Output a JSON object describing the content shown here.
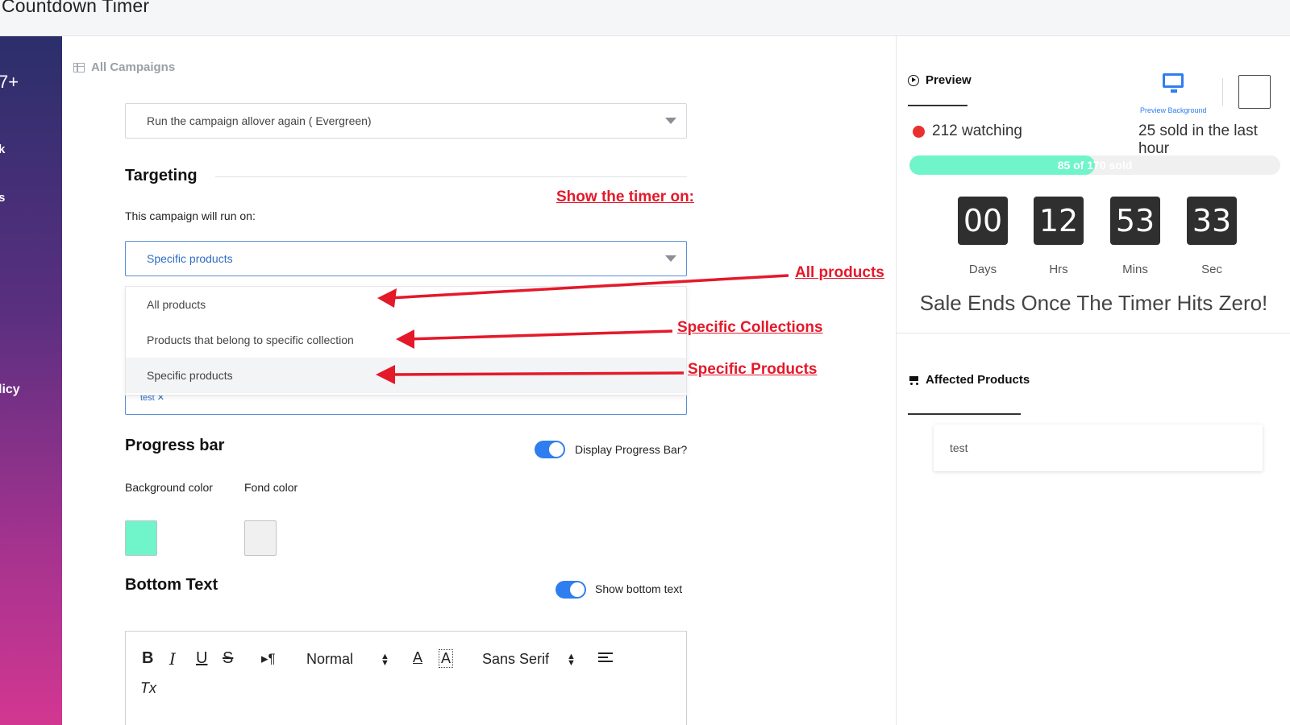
{
  "app": {
    "title": "Countdown Timer"
  },
  "sidebar": {
    "items": [
      "7+",
      "k",
      "s",
      "licy"
    ]
  },
  "breadcrumb": {
    "label": "All Campaigns"
  },
  "schedule": {
    "selected": "Run the campaign allover again ( Evergreen)"
  },
  "targeting": {
    "title": "Targeting",
    "subtitle": "This campaign will run on:",
    "selected": "Specific products",
    "options": [
      "All products",
      "Products that belong to specific collection",
      "Specific products"
    ],
    "tag": "test"
  },
  "annotations": {
    "show_timer_on": "Show the timer on:",
    "all_products": "All products",
    "specific_collections": "Specific Collections",
    "specific_products": "Specific Products",
    "color": "#e4192a"
  },
  "progress_section": {
    "title": "Progress bar",
    "toggle_label": "Display Progress Bar?",
    "bg_color_label": "Background color",
    "fond_color_label": "Fond color",
    "bg_color": "#6ff5c9",
    "fond_color": "#f0f0f0"
  },
  "bottom_text": {
    "title": "Bottom Text",
    "toggle_label": "Show bottom text",
    "toolbar": {
      "bold": "B",
      "italic": "I",
      "underline": "U",
      "strike": "S",
      "direction": "▸¶",
      "format": "Normal",
      "font": "Sans Serif",
      "clear": "Tx"
    }
  },
  "preview": {
    "tab_label": "Preview",
    "preview_bg_label": "Preview Background",
    "watching": "212 watching",
    "sold_recent": "25 sold in the last hour",
    "progress_label": "85 of 170 sold",
    "progress_fraction": 0.5,
    "timer": [
      {
        "value": "00",
        "unit": "Days"
      },
      {
        "value": "12",
        "unit": "Hrs"
      },
      {
        "value": "53",
        "unit": "Mins"
      },
      {
        "value": "33",
        "unit": "Sec"
      }
    ],
    "sale_text": "Sale Ends Once The Timer Hits Zero!"
  },
  "affected": {
    "tab_label": "Affected Products",
    "items": [
      "test"
    ]
  },
  "colors": {
    "accent": "#2f7ef0",
    "timer_bg": "#2f2f2f"
  }
}
